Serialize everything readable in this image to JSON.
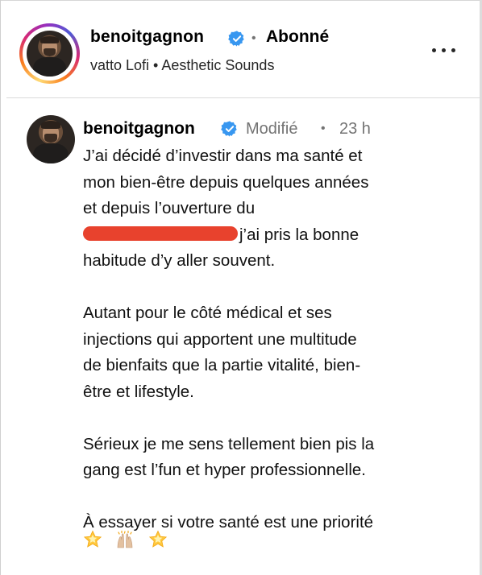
{
  "header": {
    "username": "benoitgagnon",
    "separator": "•",
    "follow_label": "Abonné",
    "audio": "vatto Lofi • Aesthetic Sounds",
    "more_icon": "more-horizontal-icon"
  },
  "post": {
    "username": "benoitgagnon",
    "edited_label": "Modifié",
    "separator": "•",
    "time": "23 h",
    "lines": {
      "l1": "J’ai décidé d’investir dans ma santé et",
      "l2": "mon bien-être depuis quelques années",
      "l3": "et depuis l’ouverture du",
      "l4_after_redaction": "j’ai pris la bonne",
      "l5": "habitude d’y aller souvent.",
      "p2_l1": "Autant pour le côté médical et ses",
      "p2_l2": "injections qui apportent une multitude",
      "p2_l3": "de bienfaits que la partie vitalité, bien-",
      "p2_l4": "être et lifestyle.",
      "p3_l1": "Sérieux je me sens tellement bien pis la",
      "p3_l2": "gang est l’fun et hyper professionnelle.",
      "p4_l1": "À essayer si votre santé est une priorité"
    },
    "emojis": [
      "glowing-star",
      "raising-hands",
      "glowing-star"
    ]
  },
  "colors": {
    "verified": "#3897f0",
    "redaction": "#e8422d",
    "muted": "#737373"
  }
}
